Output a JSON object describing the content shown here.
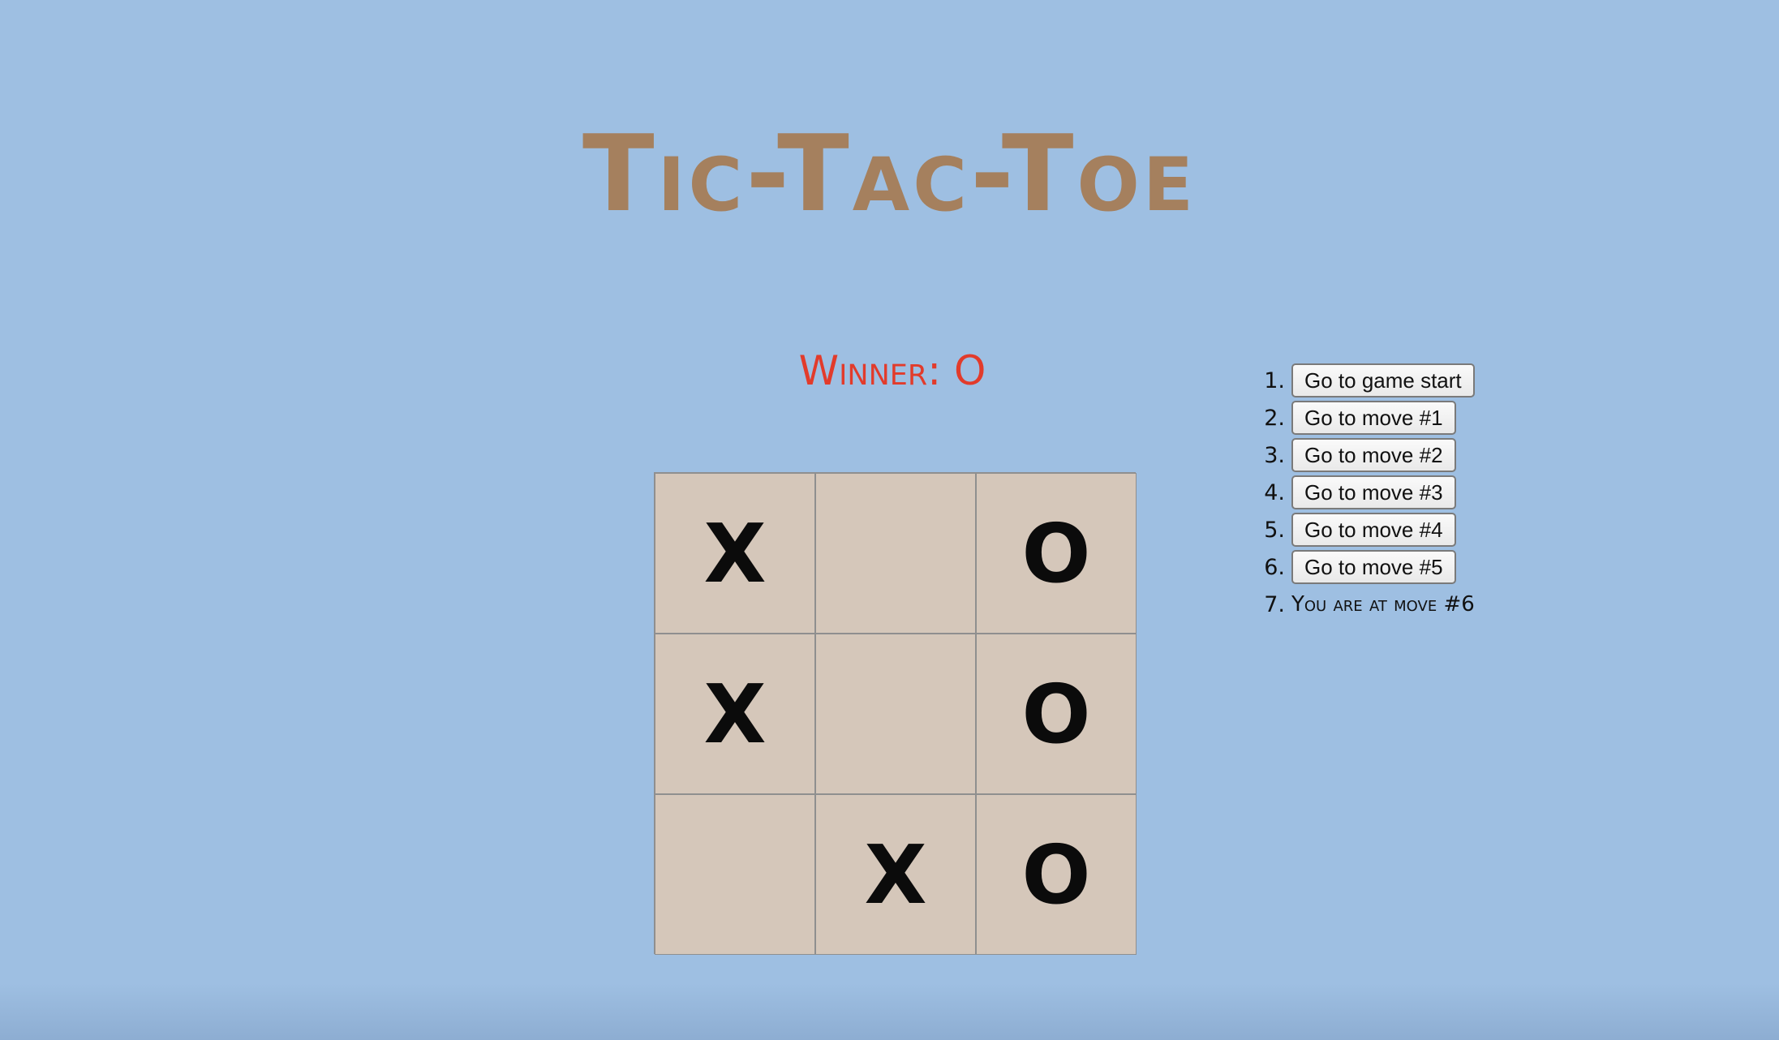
{
  "title": "Tic-Tac-Toe",
  "status": "Winner: O",
  "board": [
    "X",
    "",
    "O",
    "X",
    "",
    "O",
    "",
    "X",
    "O"
  ],
  "history": {
    "items": [
      {
        "number": "1.",
        "label": "Go to game start"
      },
      {
        "number": "2.",
        "label": "Go to move #1"
      },
      {
        "number": "3.",
        "label": "Go to move #2"
      },
      {
        "number": "4.",
        "label": "Go to move #3"
      },
      {
        "number": "5.",
        "label": "Go to move #4"
      },
      {
        "number": "6.",
        "label": "Go to move #5"
      }
    ],
    "current": {
      "number": "7.",
      "label": "You are at move #6"
    }
  },
  "colors": {
    "background": "#9ebfe2",
    "title": "#a5805e",
    "status": "#e23b2b",
    "square": "#d5c7ba"
  }
}
